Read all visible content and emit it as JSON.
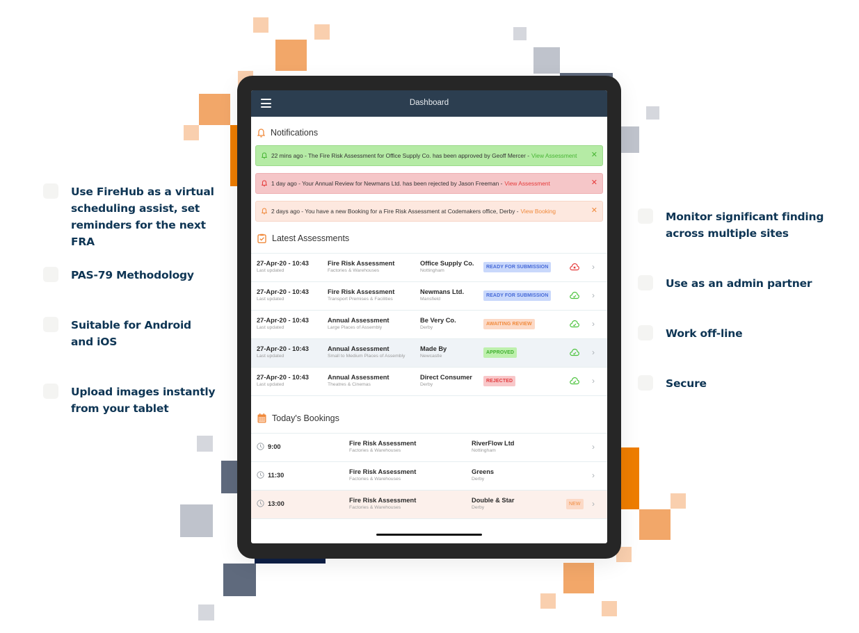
{
  "features_left": [
    {
      "text": "Use FireHub as a virtual scheduling assist, set reminders for the next FRA"
    },
    {
      "text": "PAS-79 Methodology"
    },
    {
      "text": "Suitable for Android and iOS"
    },
    {
      "text": "Upload images instantly from your tablet"
    }
  ],
  "features_right": [
    {
      "text": "Monitor significant finding across multiple sites"
    },
    {
      "text": "Use as an admin partner"
    },
    {
      "text": "Work off-line"
    },
    {
      "text": "Secure"
    }
  ],
  "app": {
    "title": "Dashboard",
    "menu_icon": "hamburger-menu-icon"
  },
  "notifications": {
    "heading": "Notifications",
    "icon": "bell-icon",
    "items": [
      {
        "message": "22 mins ago - The Fire Risk Assessment for Office Supply Co. has been approved by Geoff Mercer -",
        "link": "View Assessment",
        "status": "success",
        "color": "#49b535"
      },
      {
        "message": "1 day ago - Your Annual Review for Newmans Ltd. has been rejected by Jason Freeman -",
        "link": "View Assessment",
        "status": "error",
        "color": "#e53b3b"
      },
      {
        "message": "2 days ago - You have a new Booking for a Fire Risk Assessment at Codemakers office, Derby -",
        "link": "View Booking",
        "status": "info",
        "color": "#f08a3c"
      }
    ],
    "close_glyph": "✕"
  },
  "assessments": {
    "heading": "Latest Assessments",
    "icon": "clipboard-check-icon",
    "rows": [
      {
        "date": "27-Apr-20 - 10:43",
        "date_label": "Last updated",
        "type": "Fire Risk Assessment",
        "category": "Factories & Warehouses",
        "client": "Office Supply Co.",
        "location": "Nottingham",
        "status": "READY FOR SUBMISSION",
        "status_kind": "blue",
        "sync": "cloud-error",
        "sync_color": "#e53b3b"
      },
      {
        "date": "27-Apr-20 - 10:43",
        "date_label": "Last updated",
        "type": "Fire Risk Assessment",
        "category": "Transport Premises & Facilities",
        "client": "Newmans Ltd.",
        "location": "Mansfield",
        "status": "READY FOR SUBMISSION",
        "status_kind": "blue",
        "sync": "cloud-synced",
        "sync_color": "#49c23a"
      },
      {
        "date": "27-Apr-20 - 10:43",
        "date_label": "Last updated",
        "type": "Annual Assessment",
        "category": "Large Places of Assembly",
        "client": "Be Very Co.",
        "location": "Derby",
        "status": "AWAITING REVIEW",
        "status_kind": "orange",
        "sync": "cloud-synced",
        "sync_color": "#49c23a"
      },
      {
        "date": "27-Apr-20 - 10:43",
        "date_label": "Last updated",
        "type": "Annual Assessment",
        "category": "Small to Medium Places of Assembly",
        "client": "Made By",
        "location": "Newcastle",
        "status": "APPROVED",
        "status_kind": "green",
        "sync": "cloud-synced",
        "sync_color": "#49c23a",
        "highlighted": true
      },
      {
        "date": "27-Apr-20 - 10:43",
        "date_label": "Last updated",
        "type": "Annual Assessment",
        "category": "Theatres & Cinemas",
        "client": "Direct Consumer",
        "location": "Derby",
        "status": "REJECTED",
        "status_kind": "red",
        "sync": "cloud-synced",
        "sync_color": "#49c23a"
      }
    ]
  },
  "bookings": {
    "heading": "Today's Bookings",
    "icon": "calendar-icon",
    "rows": [
      {
        "time": "9:00",
        "type": "Fire Risk Assessment",
        "category": "Factories & Warehouses",
        "client": "RiverFlow Ltd",
        "location": "Nottingham",
        "badge": ""
      },
      {
        "time": "11:30",
        "type": "Fire Risk Assessment",
        "category": "Factories & Warehouses",
        "client": "Greens",
        "location": "Derby",
        "badge": ""
      },
      {
        "time": "13:00",
        "type": "Fire Risk Assessment",
        "category": "Factories & Warehouses",
        "client": "Double & Star",
        "location": "Derby",
        "badge": "NEW",
        "highlighted": true
      }
    ]
  },
  "colors": {
    "appbar": "#2c3e50",
    "accent_orange": "#f08a3c",
    "feature_text": "#0e3554"
  }
}
